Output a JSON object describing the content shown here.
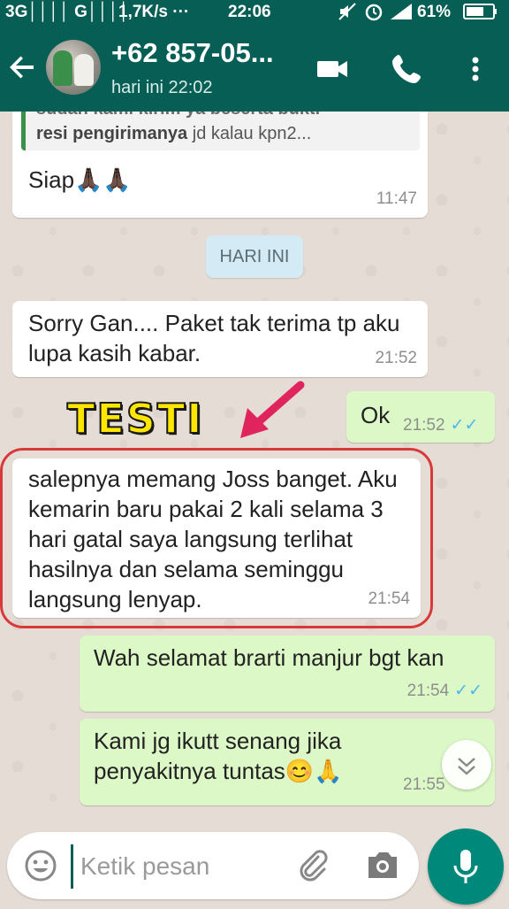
{
  "status_bar": {
    "network": "3G││││ G││││",
    "speed": "1,7K/s ···",
    "time": "22:06",
    "battery": "61%"
  },
  "header": {
    "contact_name": "+62 857-05...",
    "last_seen": "hari ini 22:02"
  },
  "quoted": {
    "line1": "sudah kami kirim ya beserta bukti",
    "line2_bold": "resi pengirimanya",
    "line2_rest": " jd kalau kpn2..."
  },
  "messages": [
    {
      "type": "in",
      "text": "Siap🙏🏿🙏🏿",
      "time": "11:47"
    },
    {
      "type": "in",
      "text": "Sorry Gan.... Paket tak terima tp aku lupa kasih kabar.",
      "time": "21:52"
    },
    {
      "type": "out",
      "text": "Ok",
      "time": "21:52",
      "ticks": "✓✓"
    },
    {
      "type": "in",
      "text": "salepnya memang Joss banget. Aku kemarin baru pakai 2 kali selama 3 hari gatal saya langsung terlihat hasilnya dan selama seminggu langsung lenyap.",
      "time": "21:54"
    },
    {
      "type": "out",
      "text": "Wah selamat brarti manjur bgt kan",
      "time": "21:54",
      "ticks": "✓✓"
    },
    {
      "type": "out",
      "text": "Kami jg ikutt senang jika penyakitnya tuntas😊🙏",
      "time": "21:55"
    }
  ],
  "day_divider": "HARI INI",
  "annotation": {
    "label": "TESTI",
    "color": "#ffe600",
    "arrow_color": "#e0245e",
    "highlight_color": "#d83a3a"
  },
  "composer": {
    "placeholder": "Ketik pesan"
  },
  "icons": [
    "back-arrow-icon",
    "video-call-icon",
    "phone-icon",
    "more-vert-icon",
    "scroll-down-icon",
    "emoji-icon",
    "attach-icon",
    "camera-icon",
    "mic-icon"
  ],
  "colors": {
    "header": "#075e54",
    "outgoing": "#dcf8c6",
    "incoming": "#ffffff",
    "chat_bg": "#e5ddd5",
    "mic": "#00897b",
    "read_ticks": "#4fb6ec"
  }
}
